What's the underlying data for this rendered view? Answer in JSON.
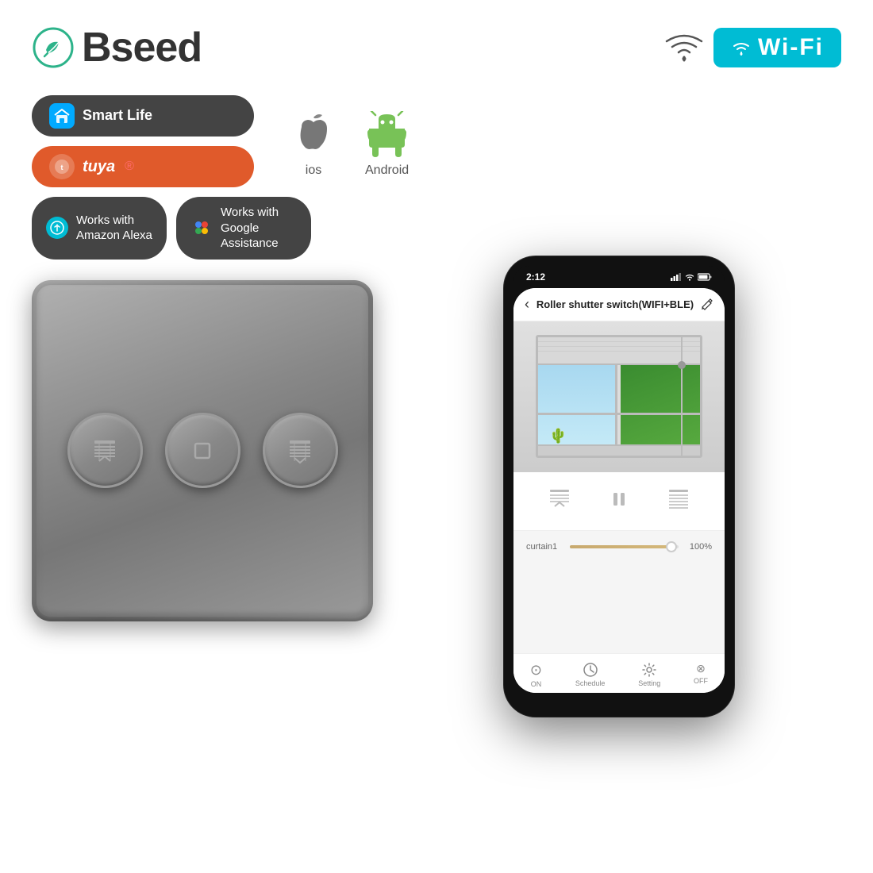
{
  "brand": {
    "name": "Bseed",
    "wifi_label": "Wi-Fi"
  },
  "badges": {
    "smart_life": "Smart Life",
    "tuya": "tuya",
    "works_alexa": "Works with\nAmazon Alexa",
    "works_google": "Works with\nGoogle Assistance",
    "ios": "ios",
    "android": "Android"
  },
  "phone": {
    "time": "2:12",
    "title": "Roller shutter switch(WIFI+BLE)",
    "curtain_label": "curtain1",
    "curtain_value": "100%",
    "nav": {
      "on": "ON",
      "on_label": "ON",
      "schedule": "Schedule",
      "setting": "Setting",
      "off": "OFF",
      "off_label": "OFF"
    }
  },
  "switch": {
    "btn1_icon": "⊟",
    "btn2_icon": "○",
    "btn3_icon": "≡"
  }
}
